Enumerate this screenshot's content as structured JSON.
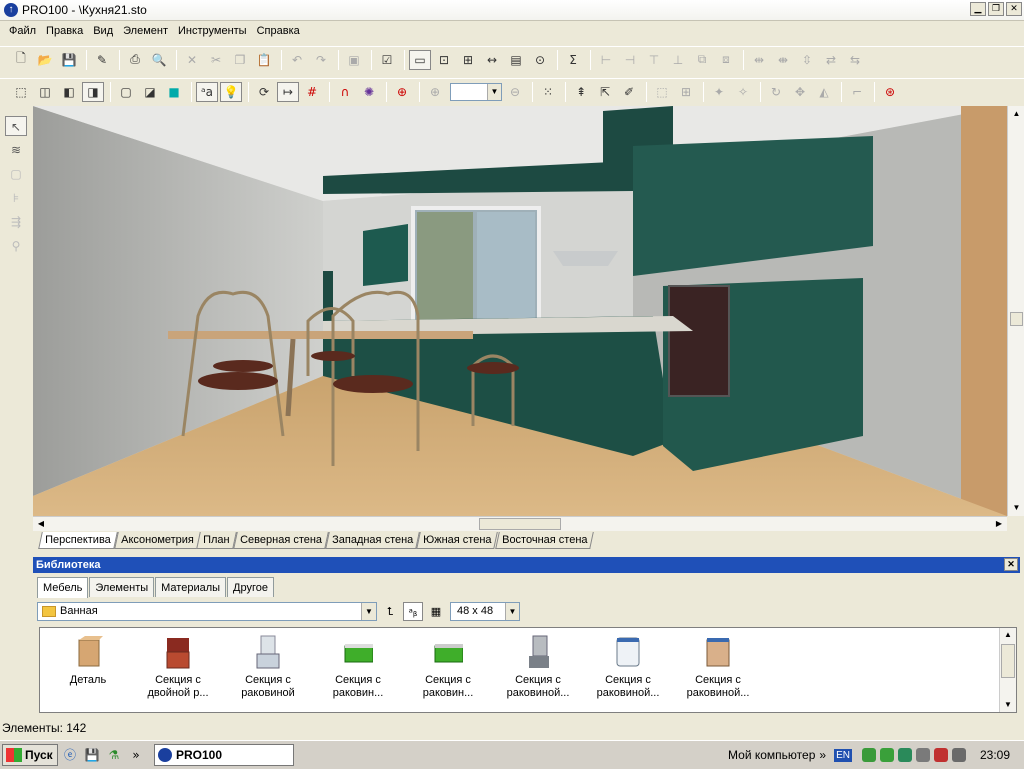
{
  "window": {
    "title": "PRO100 - \\Кухня21.sto",
    "app_icon": "pro100-logo-icon",
    "controls": [
      "minimize",
      "maximize",
      "close"
    ]
  },
  "menu": [
    "Файл",
    "Правка",
    "Вид",
    "Элемент",
    "Инструменты",
    "Справка"
  ],
  "toolbar1_icons": [
    "new-icon",
    "open-icon",
    "save-icon",
    "properties-icon",
    "print-icon",
    "print-preview-icon",
    "delete-icon",
    "cut-icon",
    "copy-icon",
    "paste-icon",
    "undo-icon",
    "redo-icon",
    "group-icon",
    "checklist-icon",
    "window-icon",
    "zoom-window-icon",
    "dimensions-icon",
    "width-icon",
    "note-icon",
    "price-icon",
    "sum-icon",
    "align-1-icon",
    "align-2-icon",
    "align-3-icon",
    "align-4-icon",
    "align-5-icon",
    "align-6-icon",
    "distribute-1-icon",
    "distribute-2-icon",
    "distribute-3-icon",
    "distribute-4-icon",
    "distribute-5-icon"
  ],
  "toolbar2_icons": [
    "wireframe-icon",
    "box-icon",
    "solid-icon",
    "textured-icon",
    "front-icon",
    "side-icon",
    "color-cube-icon",
    "text-ab-icon",
    "light-bulb-icon",
    "rotate-icon",
    "measure-icon",
    "grid-icon",
    "magnet-icon",
    "snap-icon",
    "target-icon",
    "zoom-in-icon",
    "zoom-combo",
    "zoom-out-icon",
    "select-area-icon",
    "move-up-icon",
    "arrow-move-icon",
    "edit-icon",
    "transform-1-icon",
    "transform-2-icon",
    "rotate-x-icon",
    "rotate-y-icon",
    "rotate-z-icon",
    "move-icon",
    "mirror-icon",
    "corner-icon",
    "target-2-icon"
  ],
  "left_tools": [
    "pointer-icon",
    "walls-icon",
    "box-icon",
    "dimension-icon",
    "align-icon",
    "zoom-icon"
  ],
  "view_tabs": [
    "Перспектива",
    "Аксонометрия",
    "План",
    "Северная стена",
    "Западная стена",
    "Южная стена",
    "Восточная стена"
  ],
  "library": {
    "title": "Библиотека",
    "tabs": [
      "Мебель",
      "Элементы",
      "Материалы",
      "Другое"
    ],
    "folder": "Ванная",
    "size": "48 x  48",
    "items": [
      {
        "label": "Деталь",
        "icon": "detail-cabinet-icon"
      },
      {
        "label": "Секция с двойной р...",
        "icon": "double-section-icon"
      },
      {
        "label": "Секция с раковиной",
        "icon": "sink-section-icon"
      },
      {
        "label": "Секция с раковин...",
        "icon": "green-sink-section-icon"
      },
      {
        "label": "Секция с раковин...",
        "icon": "green-sink-section-2-icon"
      },
      {
        "label": "Секция с раковиной...",
        "icon": "mirror-sink-section-icon"
      },
      {
        "label": "Секция с раковиной...",
        "icon": "white-sink-section-icon"
      },
      {
        "label": "Секция с раковиной...",
        "icon": "wood-sink-section-icon"
      }
    ]
  },
  "status": "Элементы: 142",
  "taskbar": {
    "start": "Пуск",
    "app": "PRO100",
    "my_computer": "Мой компьютер",
    "lang": "EN",
    "time": "23:09"
  }
}
